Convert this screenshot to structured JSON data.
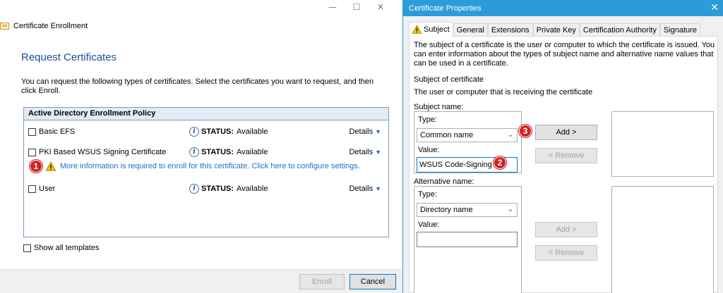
{
  "left_window": {
    "title": "Certificate Enrollment",
    "controls": {
      "minimize": "—",
      "maximize": "☐",
      "close": "✕"
    },
    "heading": "Request Certificates",
    "intro": "You can request the following types of certificates. Select the certificates you want to request, and then click Enroll.",
    "policy_title": "Active Directory Enrollment Policy",
    "status_label": "STATUS:",
    "details_label": "Details",
    "certificates": [
      {
        "name": "Basic EFS",
        "status": "Available",
        "checked": false
      },
      {
        "name": "PKI Based WSUS Signing Certificate",
        "status": "Available",
        "checked": false
      },
      {
        "name": "User",
        "status": "Available",
        "checked": false
      }
    ],
    "warning": {
      "badge": "1",
      "text": "More information is required to enroll for this certificate. Click here to configure settings."
    },
    "show_all_templates": "Show all templates",
    "buttons": {
      "enroll": "Enroll",
      "cancel": "Cancel"
    }
  },
  "right_window": {
    "title": "Certificate Properties",
    "close": "✕",
    "tabs": [
      "Subject",
      "General",
      "Extensions",
      "Private Key",
      "Certification Authority",
      "Signature"
    ],
    "active_tab": "Subject",
    "description": "The subject of a certificate is the user or computer to which the certificate is issued. You can enter information about the types of subject name and alternative name values that can be used in a certificate.",
    "subject_of_certificate": "Subject of certificate",
    "subject_hint": "The user or computer that is receiving the certificate",
    "subject_name": {
      "label": "Subject name:",
      "type_label": "Type:",
      "type_value": "Common name",
      "value_label": "Value:",
      "value": "WSUS Code-Signing",
      "value_badge": "2",
      "add_badge": "3",
      "add_button": "Add >",
      "remove_button": "< Remove"
    },
    "alternative_name": {
      "label": "Alternative name:",
      "type_label": "Type:",
      "type_value": "Directory name",
      "value_label": "Value:",
      "value": "",
      "add_button": "Add >",
      "remove_button": "< Remove"
    }
  },
  "colors": {
    "accent_blue": "#2b9cd8",
    "heading_blue": "#1f4e9a",
    "link_blue": "#1f6fc7",
    "badge_red": "#d42020",
    "warning_yellow": "#f5c400"
  }
}
